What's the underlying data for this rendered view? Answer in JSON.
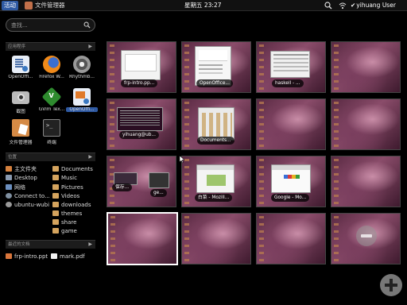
{
  "top_panel": {
    "activities": "活动",
    "app_name": "文件管理器",
    "clock": "星期五 23:27",
    "user": "yihuang User"
  },
  "search": {
    "placeholder": "查找..."
  },
  "applications": {
    "header": "应用程序",
    "items": [
      {
        "label": "OpenOffi...",
        "icon": "openoffice-writer-icon"
      },
      {
        "label": "Firefox W...",
        "icon": "firefox-icon"
      },
      {
        "label": "Rhythmb...",
        "icon": "rhythmbox-icon"
      },
      {
        "label": "截图",
        "icon": "screenshot-icon"
      },
      {
        "label": "GVim Tex...",
        "icon": "gvim-icon"
      },
      {
        "label": "OpenOffi...",
        "icon": "openoffice-impress-icon"
      },
      {
        "label": "文件管理器",
        "icon": "file-manager-icon"
      },
      {
        "label": "终端",
        "icon": "terminal-icon"
      }
    ]
  },
  "places": {
    "header": "位置",
    "left": [
      {
        "label": "主文件夹",
        "icon": "home-folder-icon"
      },
      {
        "label": "Desktop",
        "icon": "desktop-folder-icon"
      },
      {
        "label": "网络",
        "icon": "network-icon"
      },
      {
        "label": "Connect to...",
        "icon": "connect-server-icon"
      },
      {
        "label": "ubuntu-wubi",
        "icon": "drive-icon"
      }
    ],
    "right": [
      {
        "label": "Documents",
        "icon": "folder-icon"
      },
      {
        "label": "Music",
        "icon": "folder-icon"
      },
      {
        "label": "Pictures",
        "icon": "folder-icon"
      },
      {
        "label": "Videos",
        "icon": "folder-icon"
      },
      {
        "label": "downloads",
        "icon": "folder-icon"
      },
      {
        "label": "themes",
        "icon": "folder-icon"
      },
      {
        "label": "share",
        "icon": "folder-icon"
      },
      {
        "label": "game",
        "icon": "folder-icon"
      }
    ]
  },
  "recent": {
    "header": "最近的文档",
    "items": [
      {
        "label": "frp-intro.ppt",
        "icon": "presentation-file-icon"
      },
      {
        "label": "mark.pdf",
        "icon": "pdf-file-icon"
      }
    ]
  },
  "workspaces": {
    "captions": {
      "w1": "frp-intro.pp...",
      "w2": "OpenOffice...",
      "w3": "haskell - ...",
      "w5": "yihuang@ub...",
      "w6": "Documents...",
      "w9a": "保存...",
      "w9b": "ge...",
      "w10": "白菜 - Mozill...",
      "w11": "Google - Mo..."
    }
  },
  "colors": {
    "accent": "#2f5aa3",
    "panel": "#111111",
    "workspace_wallpaper": "#7a3e5e"
  }
}
